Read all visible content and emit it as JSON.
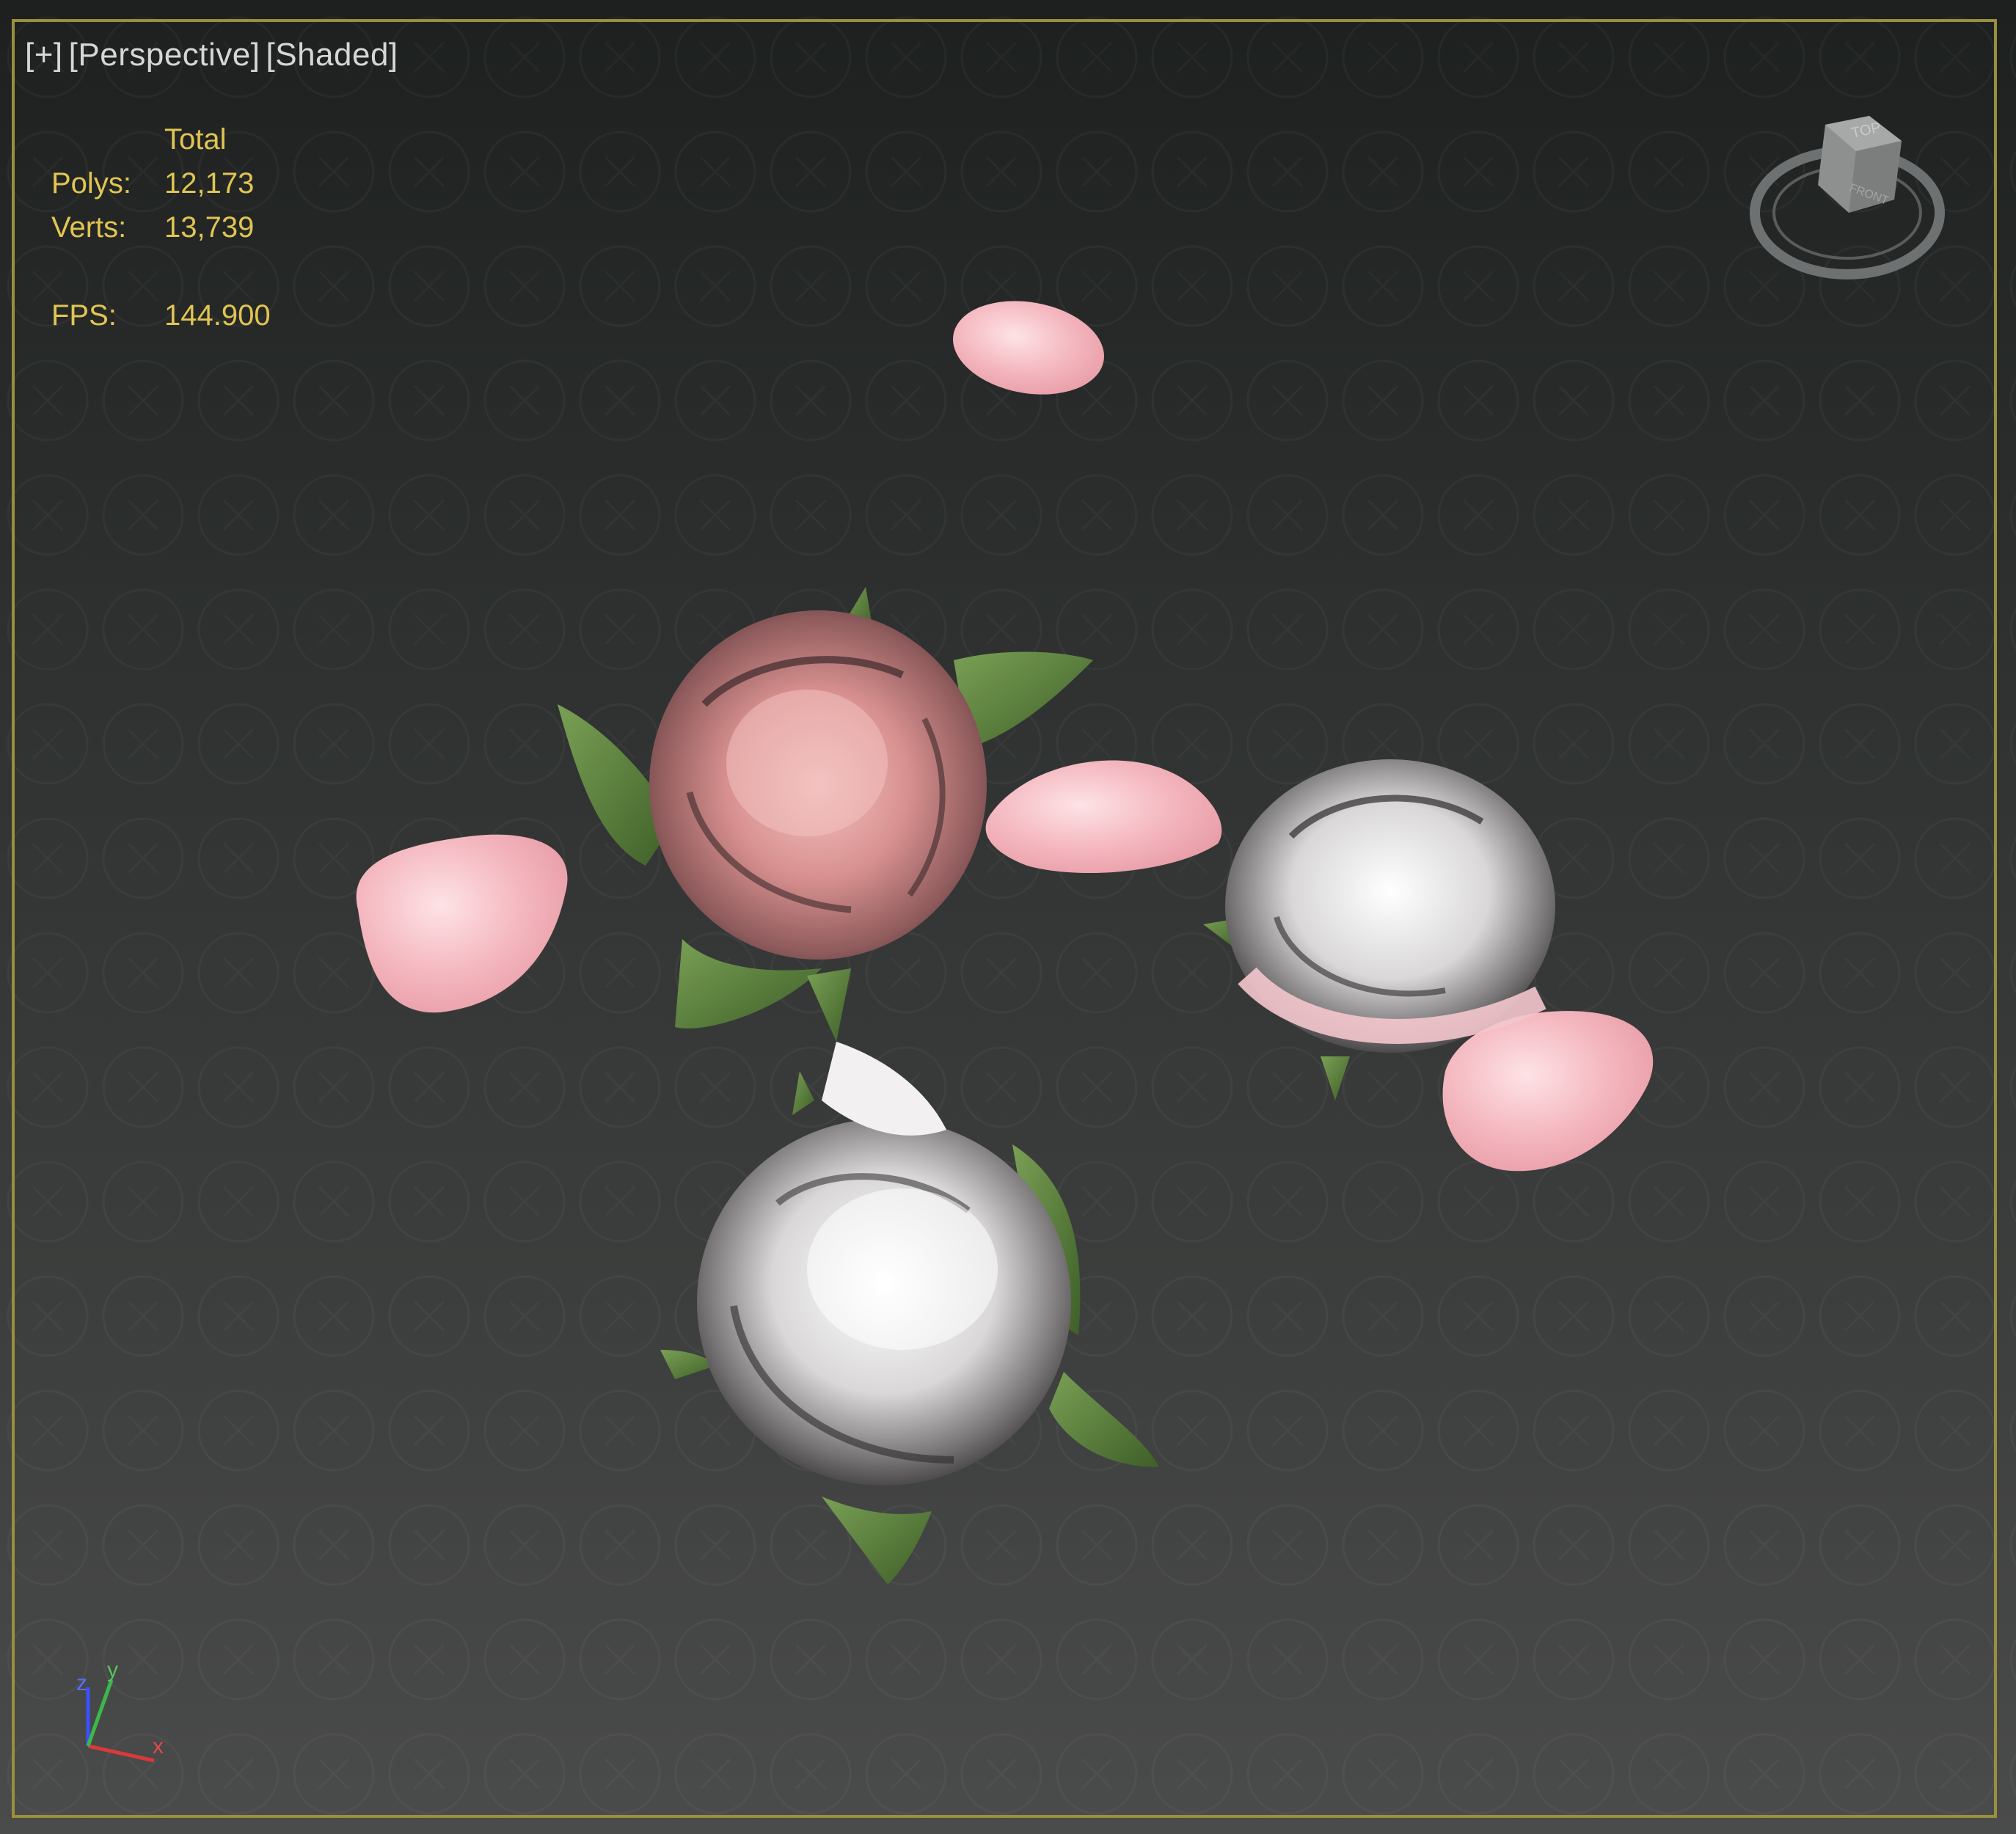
{
  "viewport": {
    "menu_label": "[+]",
    "view_label": "[Perspective]",
    "shading_label": "[Shaded]",
    "stats": {
      "header": "Total",
      "polys_label": "Polys:",
      "polys_value": "12,173",
      "verts_label": "Verts:",
      "verts_value": "13,739",
      "fps_label": "FPS:",
      "fps_value": "144.900"
    },
    "viewcube_face": "TOP",
    "viewcube_side": "FRONT",
    "axes": {
      "x": "x",
      "y": "y",
      "z": "z"
    },
    "colors": {
      "frame": "#9a8f3c",
      "stats_text": "#e1c552",
      "label_text": "#d6d6d6",
      "petal_pink": "#f2b6bd",
      "leaf_green": "#5e8a3a"
    }
  }
}
